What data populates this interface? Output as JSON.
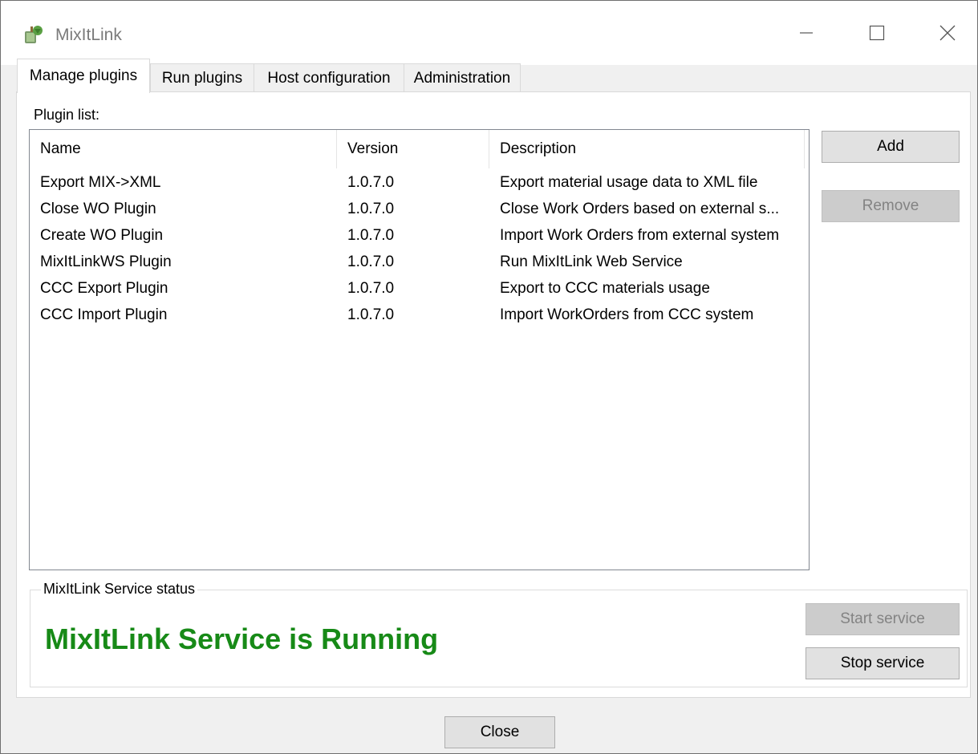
{
  "window": {
    "title": "MixItLink"
  },
  "tabs": [
    {
      "label": "Manage plugins",
      "active": true
    },
    {
      "label": "Run plugins",
      "active": false
    },
    {
      "label": "Host configuration",
      "active": false
    },
    {
      "label": "Administration",
      "active": false
    }
  ],
  "plugin_list": {
    "label": "Plugin list:",
    "columns": [
      "Name",
      "Version",
      "Description"
    ],
    "rows": [
      {
        "name": "Export MIX->XML",
        "version": "1.0.7.0",
        "description": "Export material usage data to XML file"
      },
      {
        "name": "Close WO Plugin",
        "version": "1.0.7.0",
        "description": "Close Work Orders based on external s..."
      },
      {
        "name": "Create WO Plugin",
        "version": "1.0.7.0",
        "description": "Import Work Orders from external system"
      },
      {
        "name": "MixItLinkWS Plugin",
        "version": "1.0.7.0",
        "description": "Run MixItLink Web Service"
      },
      {
        "name": "CCC Export Plugin",
        "version": "1.0.7.0",
        "description": "Export to CCC materials usage"
      },
      {
        "name": "CCC Import Plugin",
        "version": "1.0.7.0",
        "description": "Import WorkOrders from CCC system"
      }
    ]
  },
  "buttons": {
    "add": "Add",
    "remove": "Remove",
    "start_service": "Start service",
    "stop_service": "Stop service",
    "close": "Close"
  },
  "service_status": {
    "group_label": "MixItLink Service status",
    "status_text": "MixItLink Service is Running",
    "status_color": "#178a17"
  },
  "icons": {
    "app": "app-icon",
    "minimize": "minimize-icon",
    "maximize": "maximize-icon",
    "close": "close-icon"
  }
}
